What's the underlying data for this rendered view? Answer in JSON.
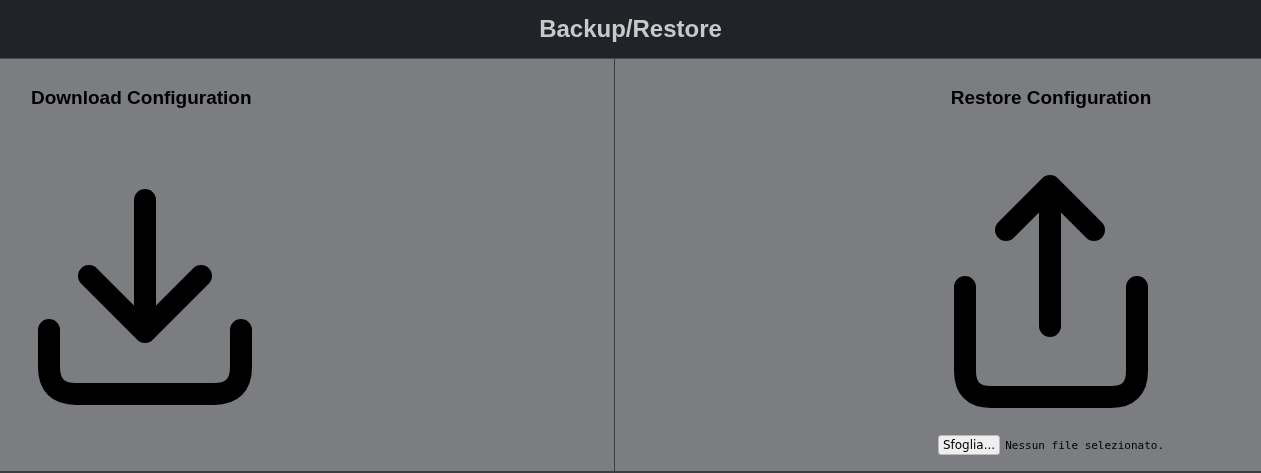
{
  "header": {
    "title": "Backup/Restore"
  },
  "download": {
    "title": "Download Configuration"
  },
  "restore": {
    "title": "Restore Configuration",
    "file_input": {
      "button": "Sfoglia...",
      "status": "Nessun file selezionato."
    }
  }
}
